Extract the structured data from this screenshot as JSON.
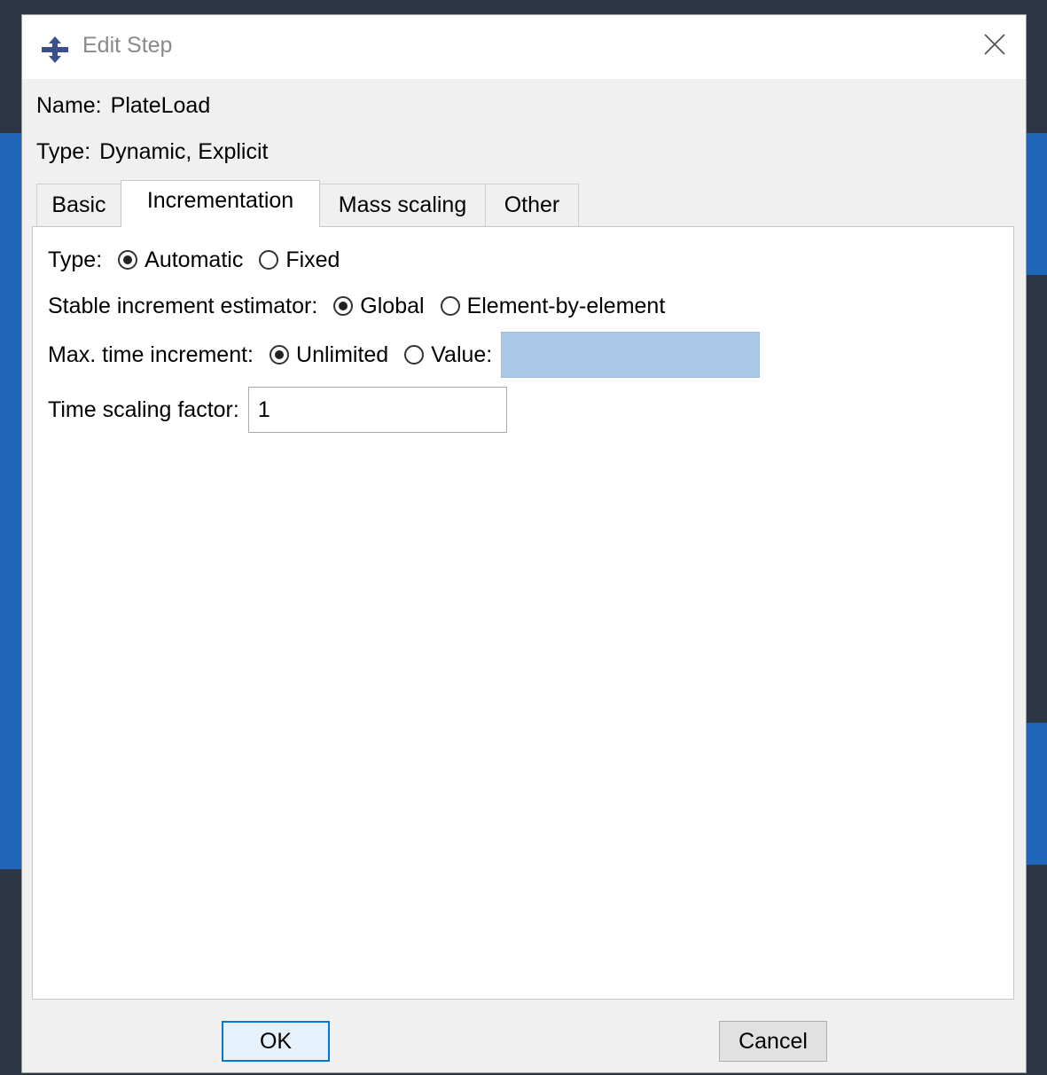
{
  "dialog": {
    "title": "Edit Step",
    "name_label": "Name:",
    "name_value": "PlateLoad",
    "type_label": "Type:",
    "type_value": "Dynamic, Explicit"
  },
  "tabs": [
    {
      "label": "Basic",
      "active": false
    },
    {
      "label": "Incrementation",
      "active": true
    },
    {
      "label": "Mass scaling",
      "active": false
    },
    {
      "label": "Other",
      "active": false
    }
  ],
  "incrementation": {
    "type_label": "Type:",
    "type_options": [
      {
        "label": "Automatic",
        "selected": true
      },
      {
        "label": "Fixed",
        "selected": false
      }
    ],
    "estimator_label": "Stable increment estimator:",
    "estimator_options": [
      {
        "label": "Global",
        "selected": true
      },
      {
        "label": "Element-by-element",
        "selected": false
      }
    ],
    "max_time_label": "Max. time increment:",
    "max_time_options": [
      {
        "label": "Unlimited",
        "selected": true
      },
      {
        "label": "Value:",
        "selected": false
      }
    ],
    "max_time_value": "",
    "time_scaling_label": "Time scaling factor:",
    "time_scaling_value": "1"
  },
  "buttons": {
    "ok": "OK",
    "cancel": "Cancel"
  },
  "colors": {
    "dialog_bg": "#f0f0f0",
    "panel_bg": "#ffffff",
    "disabled_field": "#abc8e7",
    "default_button_border": "#0078d7",
    "app_accent": "#1f66b8"
  },
  "icons": {
    "title": "abaqus-step-icon",
    "close": "close-icon"
  }
}
